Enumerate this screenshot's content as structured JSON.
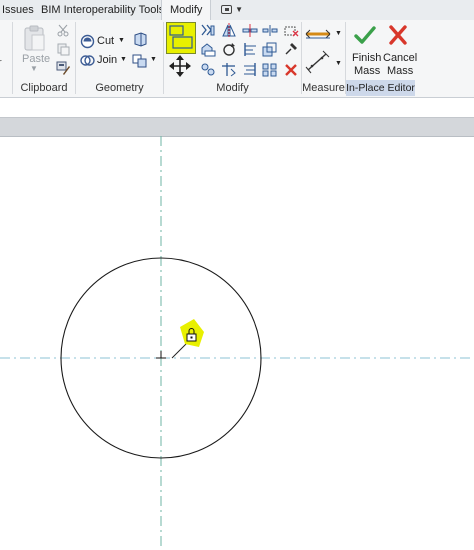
{
  "tabs": {
    "issues": "Issues",
    "bim": "BIM Interoperability Tools",
    "modify": "Modify"
  },
  "clipboard": {
    "paste_label": "Paste",
    "panel_label": "Clipboard"
  },
  "geometry": {
    "cut_label": "Cut",
    "join_label": "Join",
    "panel_label": "Geometry"
  },
  "modify": {
    "panel_label": "Modify"
  },
  "measure": {
    "panel_label": "Measure"
  },
  "inplace": {
    "finish_line1": "Finish",
    "finish_line2": "Mass",
    "cancel_line1": "Cancel",
    "cancel_line2": "Mass",
    "panel_label": "In-Place Editor"
  },
  "colors": {
    "highlight": "#e8f000",
    "ribbon_bg": "#f5f6f7",
    "editor_panel": "#cdd8ea",
    "finish_green": "#3aa04a",
    "cancel_red": "#d8372b",
    "reference_line": "#6fb6a5"
  },
  "icons": [
    "paste-icon",
    "cut-scissors-icon",
    "copy-icon",
    "match-properties-icon",
    "cut-geometry-icon",
    "join-geometry-icon",
    "align-icon",
    "move-icon",
    "modify-tool-icons",
    "measure-icon",
    "finish-check-icon",
    "cancel-x-icon"
  ]
}
